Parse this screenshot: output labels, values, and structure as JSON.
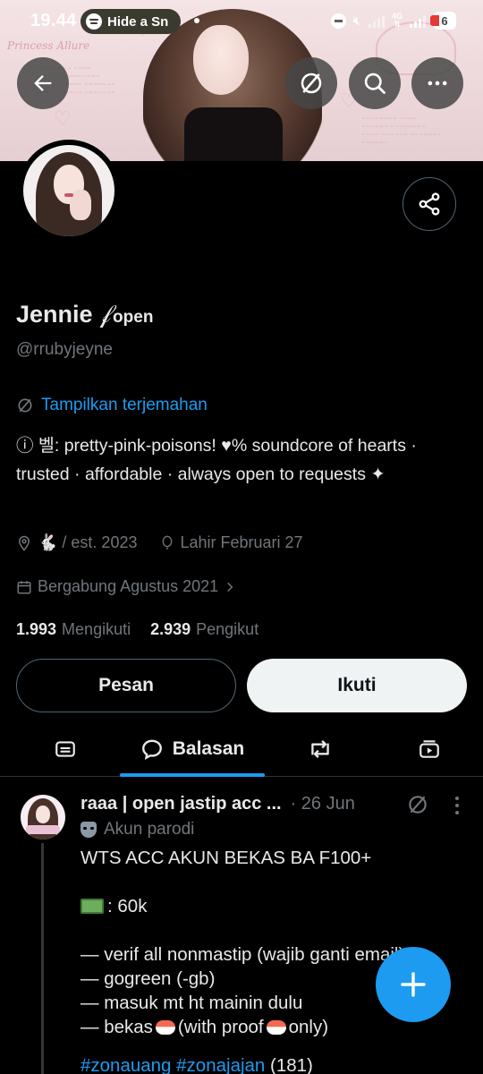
{
  "status_bar": {
    "time": "19.44",
    "media_pill_text": "Hide a Sn",
    "network": "4G",
    "battery_badge": "6"
  },
  "profile": {
    "display_name": "Jennie",
    "name_decoration": "𝒻",
    "name_suffix": "open",
    "handle": "@rrubyjeyne",
    "translate_label": "Tampilkan terjemahan",
    "bio": "ⓘ      벨: pretty-pink-poisons!   ♥%   soundcore of hearts · trusted · affordable · always open to requests ✦",
    "location": "🐇 / est. 2023",
    "birthday": "Lahir Februari 27",
    "joined": "Bergabung Agustus 2021",
    "following_count": "1.993",
    "following_label": "Mengikuti",
    "followers_count": "2.939",
    "followers_label": "Pengikut",
    "message_button": "Pesan",
    "follow_button": "Ikuti"
  },
  "tabs": {
    "replies_label": "Balasan",
    "active": "replies"
  },
  "tweet": {
    "author_name": "raaa | open jastip acc ...",
    "date": "· 26 Jun",
    "parody_label": "Akun parodi",
    "line1": "WTS ACC AKUN BEKAS BA F100+",
    "price": ": 60k",
    "item1": "— verif all nonmastip (wajib ganti email)",
    "item2": "— gogreen (-gb)",
    "item3": "— masuk mt ht mainin dulu",
    "item4_a": "— bekas",
    "item4_b": "(with proof",
    "item4_c": "only)",
    "hashtags": "#zonauang #zonajajan",
    "count_suffix": "(181)"
  },
  "icons": {
    "back": "arrow-left-icon",
    "translate": "translate-icon",
    "search": "search-icon",
    "more": "more-horizontal-icon",
    "share": "share-icon",
    "fab": "plus-icon"
  },
  "colors": {
    "accent": "#1d9bf0",
    "background": "#000000",
    "muted_text": "#71767b",
    "primary_text": "#e7e9ea"
  }
}
